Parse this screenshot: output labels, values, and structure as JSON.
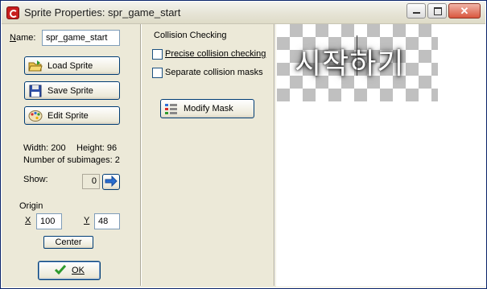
{
  "window": {
    "title": "Sprite Properties: spr_game_start"
  },
  "left": {
    "name_label": "Name:",
    "name_value": "spr_game_start",
    "load_label": "Load Sprite",
    "save_label": "Save Sprite",
    "edit_label": "Edit Sprite",
    "width_text": "Width: 200",
    "height_text": "Height: 96",
    "subimages_text": "Number of subimages: 2",
    "show_label": "Show:",
    "show_value": "0",
    "origin_label": "Origin",
    "x_label": "X",
    "x_value": "100",
    "y_label": "Y",
    "y_value": "48",
    "center_label": "Center",
    "ok_label": "OK"
  },
  "collision": {
    "heading": "Collision Checking",
    "precise_label": "Precise collision checking",
    "precise_checked": false,
    "separate_label": "Separate collision masks",
    "separate_checked": false,
    "modify_label": "Modify Mask"
  },
  "preview": {
    "sprite_text": "시작하기"
  },
  "colors": {
    "accent_border": "#003c74",
    "ok_check": "#2e9a2e",
    "arrow_blue": "#2a6fd0"
  }
}
